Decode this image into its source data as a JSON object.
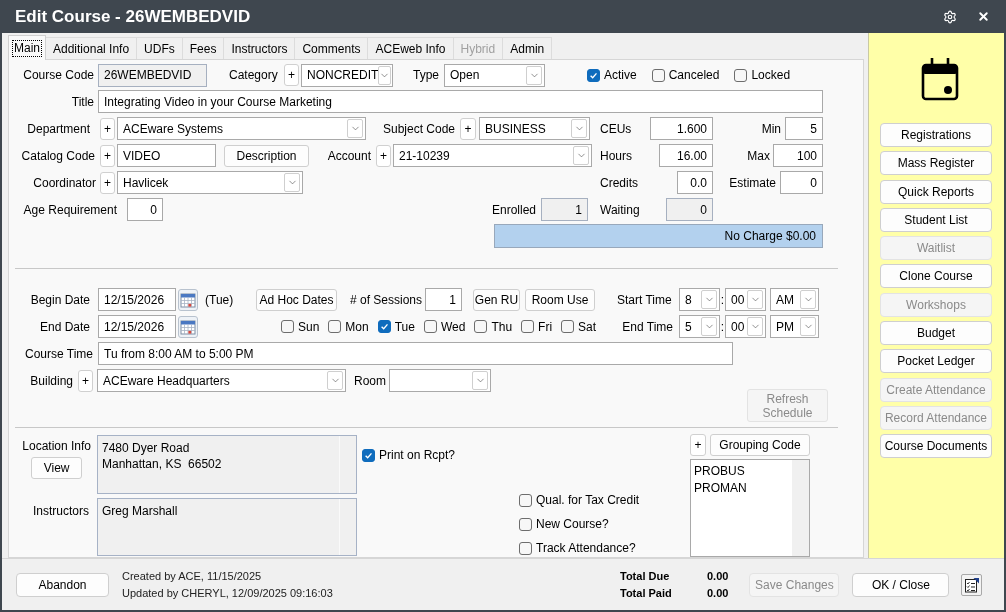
{
  "window": {
    "title": "Edit Course - 26WEMBEDVID"
  },
  "tabs": [
    {
      "label": "Main",
      "selected": true,
      "disabled": false
    },
    {
      "label": "Additional Info",
      "selected": false,
      "disabled": false
    },
    {
      "label": "UDFs",
      "selected": false,
      "disabled": false
    },
    {
      "label": "Fees",
      "selected": false,
      "disabled": false
    },
    {
      "label": "Instructors",
      "selected": false,
      "disabled": false
    },
    {
      "label": "Comments",
      "selected": false,
      "disabled": false
    },
    {
      "label": "ACEweb Info",
      "selected": false,
      "disabled": false
    },
    {
      "label": "Hybrid",
      "selected": false,
      "disabled": true
    },
    {
      "label": "Admin",
      "selected": false,
      "disabled": false
    }
  ],
  "general": {
    "course_code": {
      "label": "Course Code",
      "value": "26WEMBEDVID",
      "read_only": true
    },
    "category": {
      "label": "Category",
      "add": "+",
      "value": "NONCREDIT"
    },
    "type": {
      "label": "Type",
      "value": "Open"
    },
    "flags": [
      {
        "label": "Active",
        "checked": true
      },
      {
        "label": "Canceled",
        "checked": false
      },
      {
        "label": "Locked",
        "checked": false
      }
    ],
    "title": {
      "label": "Title",
      "value": "Integrating Video in your Course Marketing"
    },
    "department": {
      "label": "Department",
      "add": "+",
      "value": "ACEware Systems"
    },
    "subject_code": {
      "label": "Subject Code",
      "add": "+",
      "value": "BUSINESS"
    },
    "ceus": {
      "label": "CEUs",
      "value": "1.600"
    },
    "min": {
      "label": "Min",
      "value": "5"
    },
    "catalog_code": {
      "label": "Catalog Code",
      "add": "+",
      "value": "VIDEO"
    },
    "description_button": "Description",
    "account": {
      "label": "Account",
      "add": "+",
      "value": "21-10239"
    },
    "hours": {
      "label": "Hours",
      "value": "16.00"
    },
    "max": {
      "label": "Max",
      "value": "100"
    },
    "coordinator": {
      "label": "Coordinator",
      "add": "+",
      "value": "Havlicek"
    },
    "credits": {
      "label": "Credits",
      "value": "0.0"
    },
    "estimate": {
      "label": "Estimate",
      "value": "0"
    },
    "age_requirement": {
      "label": "Age Requirement",
      "value": "0"
    },
    "enrolled": {
      "label": "Enrolled",
      "value": "1",
      "read_only": true
    },
    "waiting": {
      "label": "Waiting",
      "value": "0",
      "read_only": true
    },
    "charge": "No Charge $0.00"
  },
  "schedule": {
    "begin_date": {
      "label": "Begin Date",
      "value": "12/15/2026",
      "weekday": "(Tue)"
    },
    "ad_hoc_button": "Ad Hoc Dates",
    "sessions": {
      "label": "# of Sessions",
      "value": "1"
    },
    "gen_ru_button": "Gen RU",
    "room_use_button": "Room Use",
    "start_time": {
      "label": "Start Time",
      "hour": "8",
      "separator": ":",
      "minute": "00",
      "period": "AM"
    },
    "end_date": {
      "label": "End Date",
      "value": "12/15/2026"
    },
    "days": [
      {
        "label": "Sun",
        "checked": false
      },
      {
        "label": "Mon",
        "checked": false
      },
      {
        "label": "Tue",
        "checked": true
      },
      {
        "label": "Wed",
        "checked": false
      },
      {
        "label": "Thu",
        "checked": false
      },
      {
        "label": "Fri",
        "checked": false
      },
      {
        "label": "Sat",
        "checked": false
      }
    ],
    "end_time": {
      "label": "End Time",
      "hour": "5",
      "separator": ":",
      "minute": "00",
      "period": "PM"
    },
    "course_time": {
      "label": "Course Time",
      "value": "Tu from 8:00 AM to 5:00 PM"
    },
    "building": {
      "label": "Building",
      "add": "+",
      "value": "ACEware Headquarters"
    },
    "room": {
      "label": "Room"
    },
    "refresh_button": {
      "label": "Refresh Schedule",
      "disabled": true
    }
  },
  "details": {
    "location_info": {
      "label": "Location Info",
      "view_button": "View",
      "lines": [
        "7480 Dyer Road",
        "Manhattan, KS  66502"
      ]
    },
    "print_on_receipt": {
      "label": "Print on Rcpt?",
      "checked": true
    },
    "grouping_code": {
      "add": "+",
      "button": "Grouping Code",
      "items": [
        "PROBUS",
        "PROMAN"
      ]
    },
    "instructors": {
      "label": "Instructors",
      "lines": [
        "Greg Marshall"
      ]
    },
    "options": [
      {
        "label": "Qual. for Tax Credit",
        "checked": false
      },
      {
        "label": "New Course?",
        "checked": false
      },
      {
        "label": "Track Attendance?",
        "checked": false
      }
    ]
  },
  "sidebar": {
    "buttons": [
      {
        "label": "Registrations",
        "disabled": false
      },
      {
        "label": "Mass Register",
        "disabled": false
      },
      {
        "label": "Quick Reports",
        "disabled": false
      },
      {
        "label": "Student List",
        "disabled": false
      },
      {
        "label": "Waitlist",
        "disabled": true
      },
      {
        "label": "Clone Course",
        "disabled": false
      },
      {
        "label": "Workshops",
        "disabled": true
      },
      {
        "label": "Budget",
        "disabled": false
      },
      {
        "label": "Pocket Ledger",
        "disabled": false
      },
      {
        "label": "Create Attendance",
        "disabled": true
      },
      {
        "label": "Record Attendance",
        "disabled": true
      },
      {
        "label": "Course Documents",
        "disabled": false
      }
    ]
  },
  "footer": {
    "abandon_button": "Abandon",
    "created": "Created by ACE, 11/15/2025",
    "updated": "Updated by CHERYL, 12/09/2025 09:16:03",
    "totals": [
      {
        "label": "Total Due",
        "value": "0.00"
      },
      {
        "label": "Total Paid",
        "value": "0.00"
      }
    ],
    "save_button": {
      "label": "Save Changes",
      "disabled": true
    },
    "ok_button": {
      "label": "OK / Close",
      "disabled": false
    }
  }
}
